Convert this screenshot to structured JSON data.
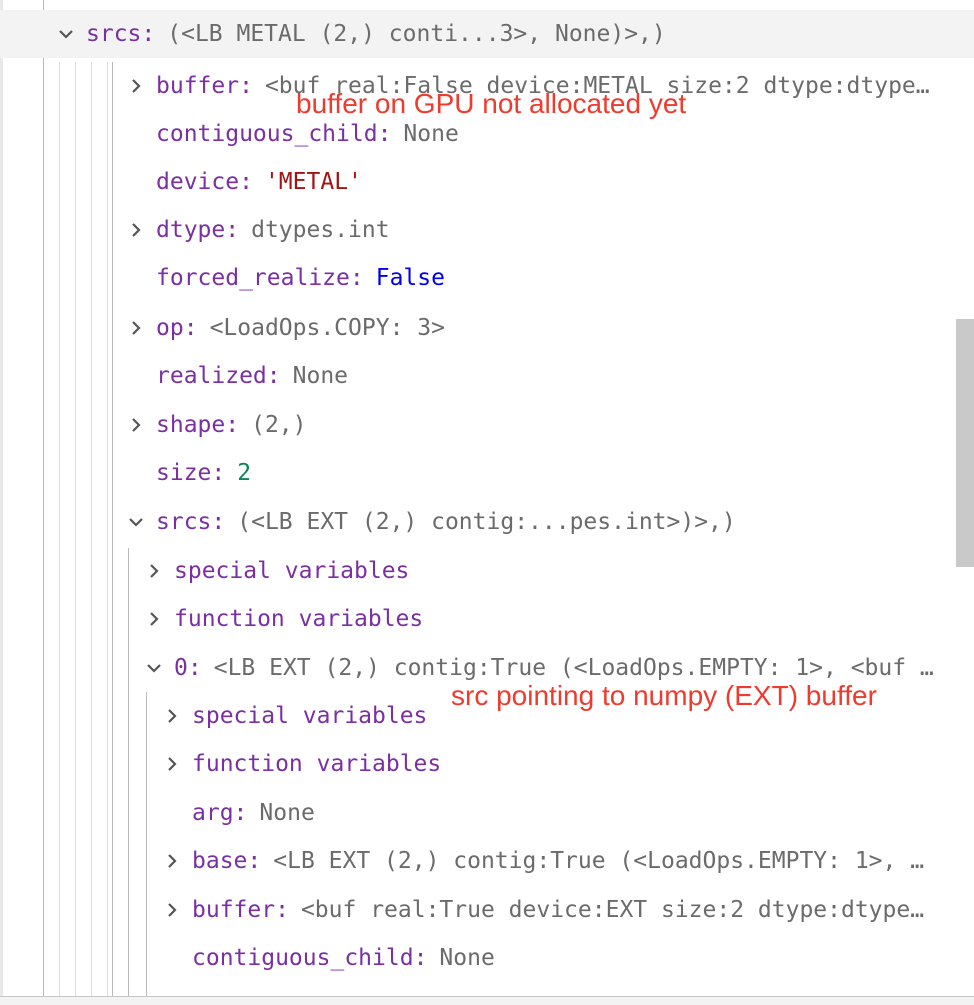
{
  "rows": [
    {
      "key": "srcs",
      "value": "(<LB METAL (2,) conti...3>, None)>,)",
      "type": "plain",
      "twistie": "expanded"
    },
    {
      "key": "buffer",
      "value": "<buf real:False device:METAL size:2 dtype:dtype…",
      "type": "plain",
      "twistie": "collapsed"
    },
    {
      "key": "contiguous_child",
      "value": "None",
      "type": "plain",
      "twistie": "none"
    },
    {
      "key": "device",
      "value": "'METAL'",
      "type": "str",
      "twistie": "none"
    },
    {
      "key": "dtype",
      "value": "dtypes.int",
      "type": "plain",
      "twistie": "collapsed"
    },
    {
      "key": "forced_realize",
      "value": "False",
      "type": "bool",
      "twistie": "none"
    },
    {
      "key": "op",
      "value": "<LoadOps.COPY: 3>",
      "type": "plain",
      "twistie": "collapsed"
    },
    {
      "key": "realized",
      "value": "None",
      "type": "plain",
      "twistie": "none"
    },
    {
      "key": "shape",
      "value": "(2,)",
      "type": "plain",
      "twistie": "collapsed"
    },
    {
      "key": "size",
      "value": "2",
      "type": "num",
      "twistie": "none"
    },
    {
      "key": "srcs",
      "value": "(<LB EXT (2,) contig:...pes.int>)>,)",
      "type": "plain",
      "twistie": "expanded"
    },
    {
      "key": "special variables",
      "value": "",
      "type": "plain",
      "twistie": "collapsed"
    },
    {
      "key": "function variables",
      "value": "",
      "type": "plain",
      "twistie": "collapsed"
    },
    {
      "key": "0",
      "value": "<LB EXT (2,) contig:True (<LoadOps.EMPTY: 1>, <buf …",
      "type": "plain",
      "twistie": "expanded"
    },
    {
      "key": "special variables",
      "value": "",
      "type": "plain",
      "twistie": "collapsed"
    },
    {
      "key": "function variables",
      "value": "",
      "type": "plain",
      "twistie": "collapsed"
    },
    {
      "key": "arg",
      "value": "None",
      "type": "plain",
      "twistie": "none"
    },
    {
      "key": "base",
      "value": "<LB EXT (2,) contig:True (<LoadOps.EMPTY: 1>, …",
      "type": "plain",
      "twistie": "collapsed"
    },
    {
      "key": "buffer",
      "value": "<buf real:True device:EXT size:2 dtype:dtype…",
      "type": "plain",
      "twistie": "collapsed"
    },
    {
      "key": "contiguous_child",
      "value": "None",
      "type": "plain",
      "twistie": "none"
    }
  ],
  "annotations": {
    "gpu_note": "buffer on GPU not allocated yet",
    "ext_note": "src pointing to numpy (EXT) buffer"
  },
  "colors": {
    "key": "#7a2fa3",
    "value": "#6b6b6b",
    "string": "#a31515",
    "boolean": "#0000ee",
    "number": "#098658",
    "annotation": "#ef3b2d"
  }
}
